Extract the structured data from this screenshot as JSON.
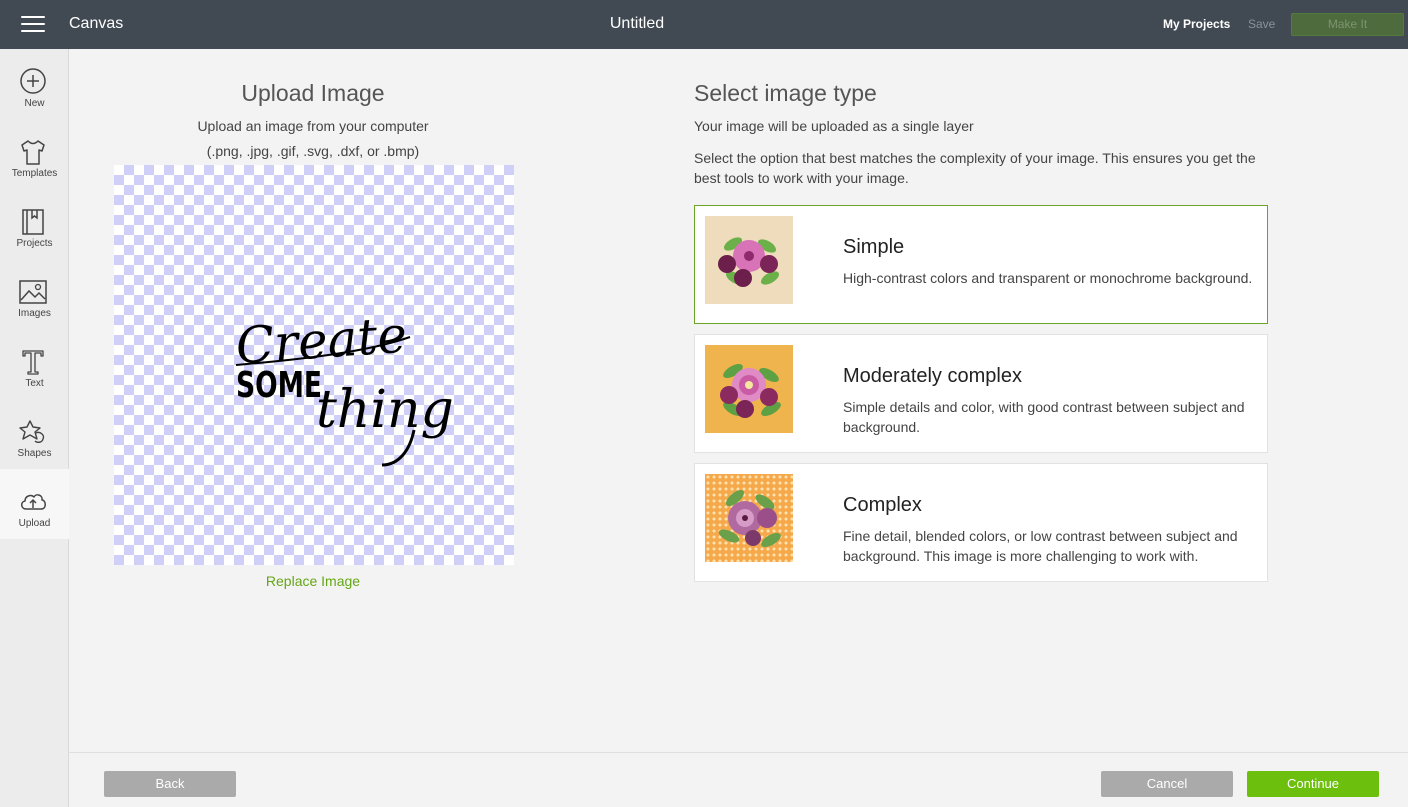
{
  "header": {
    "app_title": "Canvas",
    "doc_title": "Untitled",
    "my_projects": "My Projects",
    "save": "Save",
    "make_it": "Make It"
  },
  "sidebar": {
    "items": [
      {
        "label": "New",
        "icon": "plus-circle-icon"
      },
      {
        "label": "Templates",
        "icon": "tshirt-icon"
      },
      {
        "label": "Projects",
        "icon": "projects-book-icon"
      },
      {
        "label": "Images",
        "icon": "image-icon"
      },
      {
        "label": "Text",
        "icon": "text-icon"
      },
      {
        "label": "Shapes",
        "icon": "shapes-icon"
      },
      {
        "label": "Upload",
        "icon": "upload-cloud-icon"
      }
    ],
    "active": "Upload"
  },
  "upload": {
    "title": "Upload Image",
    "subtitle": "Upload an image from your computer",
    "formats": "(.png, .jpg, .gif, .svg, .dxf, or .bmp)",
    "preview_text": [
      "Create",
      "SOME",
      "thing"
    ],
    "replace_label": "Replace Image"
  },
  "image_type": {
    "title": "Select image type",
    "subtitle": "Your image will be uploaded as a single layer",
    "description": "Select the option that best matches the complexity of your image. This ensures you get the best tools to work with your image.",
    "options": [
      {
        "name": "Simple",
        "description": "High-contrast colors and transparent or monochrome background.",
        "selected": true,
        "thumb_bg": "#efdcbd"
      },
      {
        "name": "Moderately complex",
        "description": "Simple details and color, with good contrast between subject and background.",
        "selected": false,
        "thumb_bg": "#f0b44e"
      },
      {
        "name": "Complex",
        "description": "Fine detail, blended colors, or low contrast between subject and background. This image is more challenging to work with.",
        "selected": false,
        "thumb_bg": "#f5a94a"
      }
    ]
  },
  "footer": {
    "back": "Back",
    "cancel": "Cancel",
    "continue": "Continue"
  },
  "colors": {
    "topbar": "#414a52",
    "accent_green": "#6cbf0c",
    "link_green": "#64a615",
    "selected_border": "#6aa427"
  }
}
